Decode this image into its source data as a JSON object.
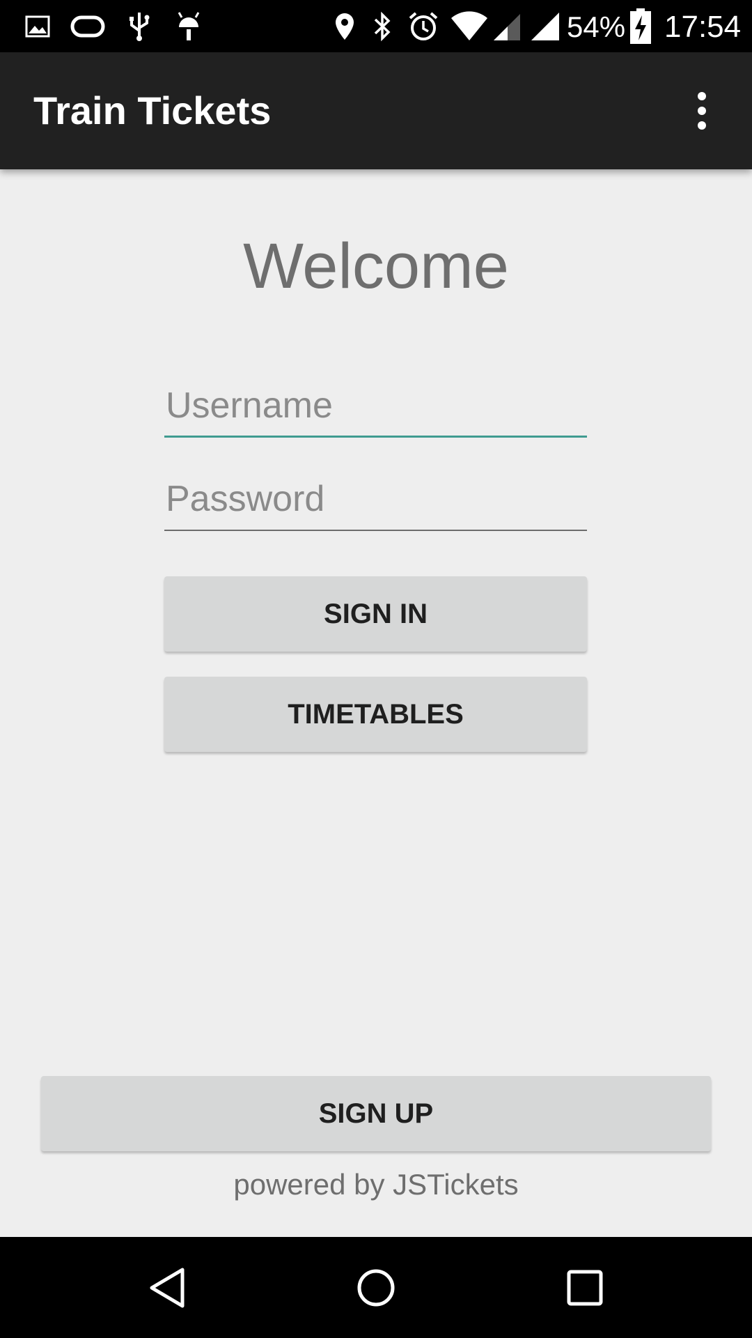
{
  "status_bar": {
    "battery_percent": "54%",
    "time": "17:54",
    "icons": [
      "gallery-icon",
      "sync-icon",
      "usb-icon",
      "android-debug-icon",
      "location-icon",
      "bluetooth-icon",
      "alarm-icon",
      "wifi-icon",
      "signal-icon",
      "signal-icon",
      "battery-charging-icon"
    ]
  },
  "app_bar": {
    "title": "Train Tickets",
    "overflow_icon": "more-vert-icon"
  },
  "login": {
    "welcome": "Welcome",
    "username_placeholder": "Username",
    "password_placeholder": "Password",
    "sign_in_label": "SIGN IN",
    "timetables_label": "TIMETABLES"
  },
  "footer": {
    "sign_up_label": "SIGN UP",
    "powered_by": "powered by JSTickets"
  },
  "nav_bar": {
    "icons": [
      "back-icon",
      "home-icon",
      "recents-icon"
    ]
  },
  "colors": {
    "app_bar": "#212121",
    "background": "#eeeeee",
    "accent": "#3f9b90",
    "button": "#d6d7d7"
  }
}
